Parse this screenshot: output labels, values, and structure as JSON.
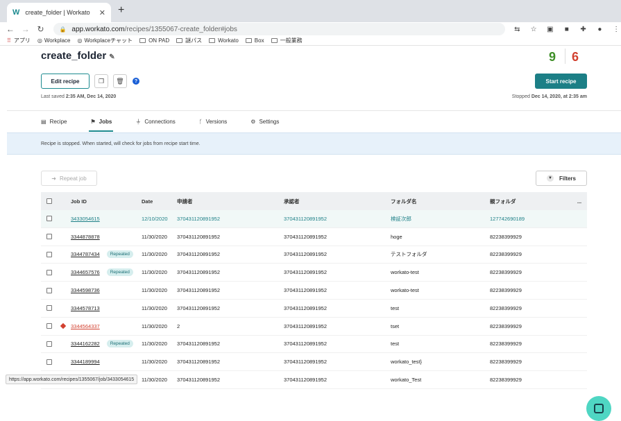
{
  "browser": {
    "tab_title": "create_folder | Workato",
    "tab_logo": "W",
    "url_host": "app.workato.com",
    "url_path": "/recipes/1355067-create_folder#jobs",
    "bookmarks": [
      "アプリ",
      "Workplace",
      "Workplaceチャット",
      "ON PAD",
      "謎パス",
      "Workato",
      "Box",
      "一般業務"
    ]
  },
  "recipe": {
    "name": "create_folder",
    "success_count": "9",
    "failed_count": "6",
    "edit_label": "Edit recipe",
    "start_label": "Start recipe",
    "last_saved_prefix": "Last saved",
    "last_saved_time": "2:35 AM, Dec 14, 2020",
    "stopped_prefix": "Stopped",
    "stopped_time": "Dec 14, 2020, at 2:35 am",
    "help_glyph": "?"
  },
  "tabs": [
    "Recipe",
    "Jobs",
    "Connections",
    "Versions",
    "Settings"
  ],
  "banner": "Recipe is stopped. When started, will check for jobs from recipe start time.",
  "actions": {
    "repeat": "Repeat job",
    "filters": "Filters"
  },
  "table": {
    "headers": [
      "Job ID",
      "Date",
      "申請者",
      "承認者",
      "フォルダ名",
      "親フォルダ",
      "..."
    ],
    "rows": [
      {
        "id": "3433054615",
        "date": "12/10/2020",
        "applicant": "370431120891952",
        "approver": "370431120891952",
        "folder": "検証次郎",
        "parent": "127742690189"
      },
      {
        "id": "3344878878",
        "date": "11/30/2020",
        "applicant": "370431120891952",
        "approver": "370431120891952",
        "folder": "hoge",
        "parent": "82238399929"
      },
      {
        "id": "3344787434",
        "badge": "Repeated",
        "date": "11/30/2020",
        "applicant": "370431120891952",
        "approver": "370431120891952",
        "folder": "テストフォルダ",
        "parent": "82238399929"
      },
      {
        "id": "3344657576",
        "badge": "Repeated",
        "date": "11/30/2020",
        "applicant": "370431120891952",
        "approver": "370431120891952",
        "folder": "workato-test",
        "parent": "82238399929"
      },
      {
        "id": "3344598736",
        "date": "11/30/2020",
        "applicant": "370431120891952",
        "approver": "370431120891952",
        "folder": "workato-test",
        "parent": "82238399929"
      },
      {
        "id": "3344578713",
        "date": "11/30/2020",
        "applicant": "370431120891952",
        "approver": "370431120891952",
        "folder": "test",
        "parent": "82238399929"
      },
      {
        "id": "3344564337",
        "error": true,
        "date": "11/30/2020",
        "applicant": "2",
        "approver": "370431120891952",
        "folder": "tset",
        "parent": "82238399929"
      },
      {
        "id": "3344162282",
        "badge": "Repeated",
        "date": "11/30/2020",
        "applicant": "370431120891952",
        "approver": "370431120891952",
        "folder": "test",
        "parent": "82238399929"
      },
      {
        "id": "3344189994",
        "date": "11/30/2020",
        "applicant": "370431120891952",
        "approver": "370431120891952",
        "folder": "workato_test}",
        "parent": "82238399929"
      },
      {
        "id": "",
        "date": "11/30/2020",
        "applicant": "370431120891952",
        "approver": "370431120891952",
        "folder": "workato_Test",
        "parent": "82238399929"
      }
    ]
  },
  "status_url": "https://app.workato.com/recipes/1355067/job/3433054615",
  "colors": {
    "accent": "#1c8a8f",
    "success": "#3f8f28",
    "failed": "#d2402f",
    "banner": "#e7f1fa"
  }
}
